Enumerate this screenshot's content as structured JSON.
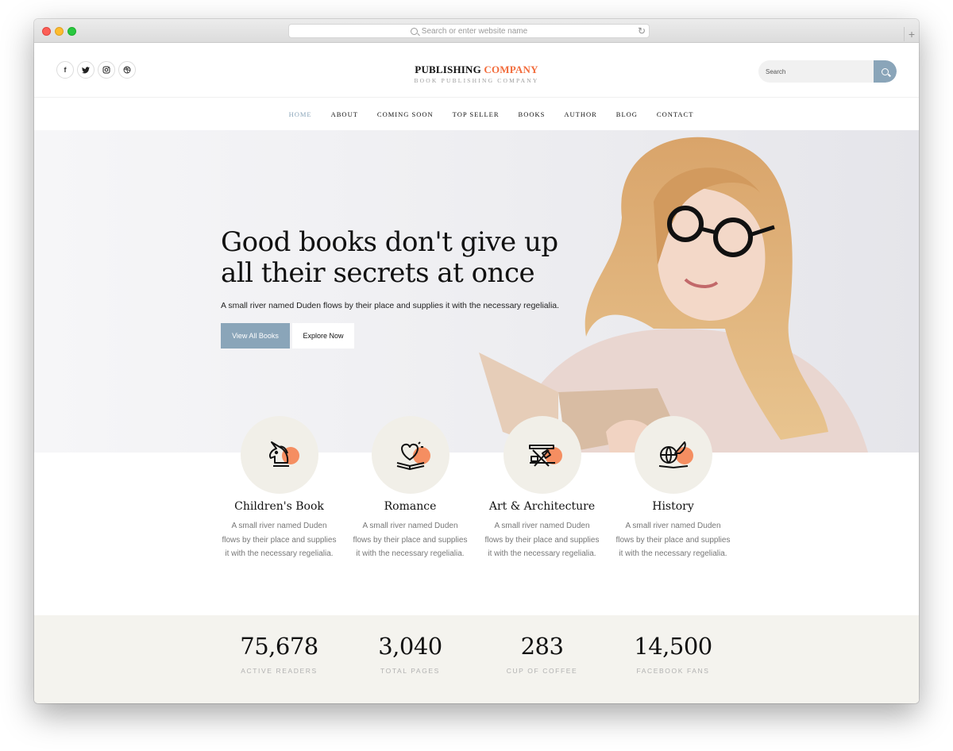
{
  "browser": {
    "url_placeholder": "Search or enter website name",
    "new_tab": "+",
    "reload": "↻"
  },
  "header": {
    "social_icons": [
      "facebook-icon",
      "twitter-icon",
      "instagram-icon",
      "dribbble-icon"
    ],
    "social_glyphs": [
      "f",
      "t",
      "◎",
      "⊛"
    ],
    "logo_main": "PUBLISHING",
    "logo_accent": "COMPANY",
    "logo_tagline": "BOOK PUBLISHING COMPANY",
    "search_placeholder": "Search"
  },
  "nav": {
    "items": [
      "HOME",
      "ABOUT",
      "COMING SOON",
      "TOP SELLER",
      "BOOKS",
      "AUTHOR",
      "BLOG",
      "CONTACT"
    ],
    "active": "HOME"
  },
  "hero": {
    "heading_line1": "Good books don't give up",
    "heading_line2": "all their secrets at once",
    "subtext": "A small river named Duden flows by their place and supplies it with the necessary regelialia.",
    "primary_button": "View All Books",
    "secondary_button": "Explore Now"
  },
  "categories": [
    {
      "title": "Children's Book",
      "icon": "unicorn-icon",
      "desc": "A small river named Duden flows by their place and supplies it with the necessary regelialia."
    },
    {
      "title": "Romance",
      "icon": "heart-book-icon",
      "desc": "A small river named Duden flows by their place and supplies it with the necessary regelialia."
    },
    {
      "title": "Art & Architecture",
      "icon": "art-tools-icon",
      "desc": "A small river named Duden flows by their place and supplies it with the necessary regelialia."
    },
    {
      "title": "History",
      "icon": "globe-quill-icon",
      "desc": "A small river named Duden flows by their place and supplies it with the necessary regelialia."
    }
  ],
  "stats": [
    {
      "value": "75,678",
      "label": "ACTIVE READERS"
    },
    {
      "value": "3,040",
      "label": "TOTAL PAGES"
    },
    {
      "value": "283",
      "label": "CUP OF COFFEE"
    },
    {
      "value": "14,500",
      "label": "FACEBOOK FANS"
    }
  ],
  "colors": {
    "accent": "#f26d3d",
    "primary_button": "#8aa5b9",
    "icon_blob": "#f58e61",
    "stats_bg": "#f4f3ee"
  }
}
